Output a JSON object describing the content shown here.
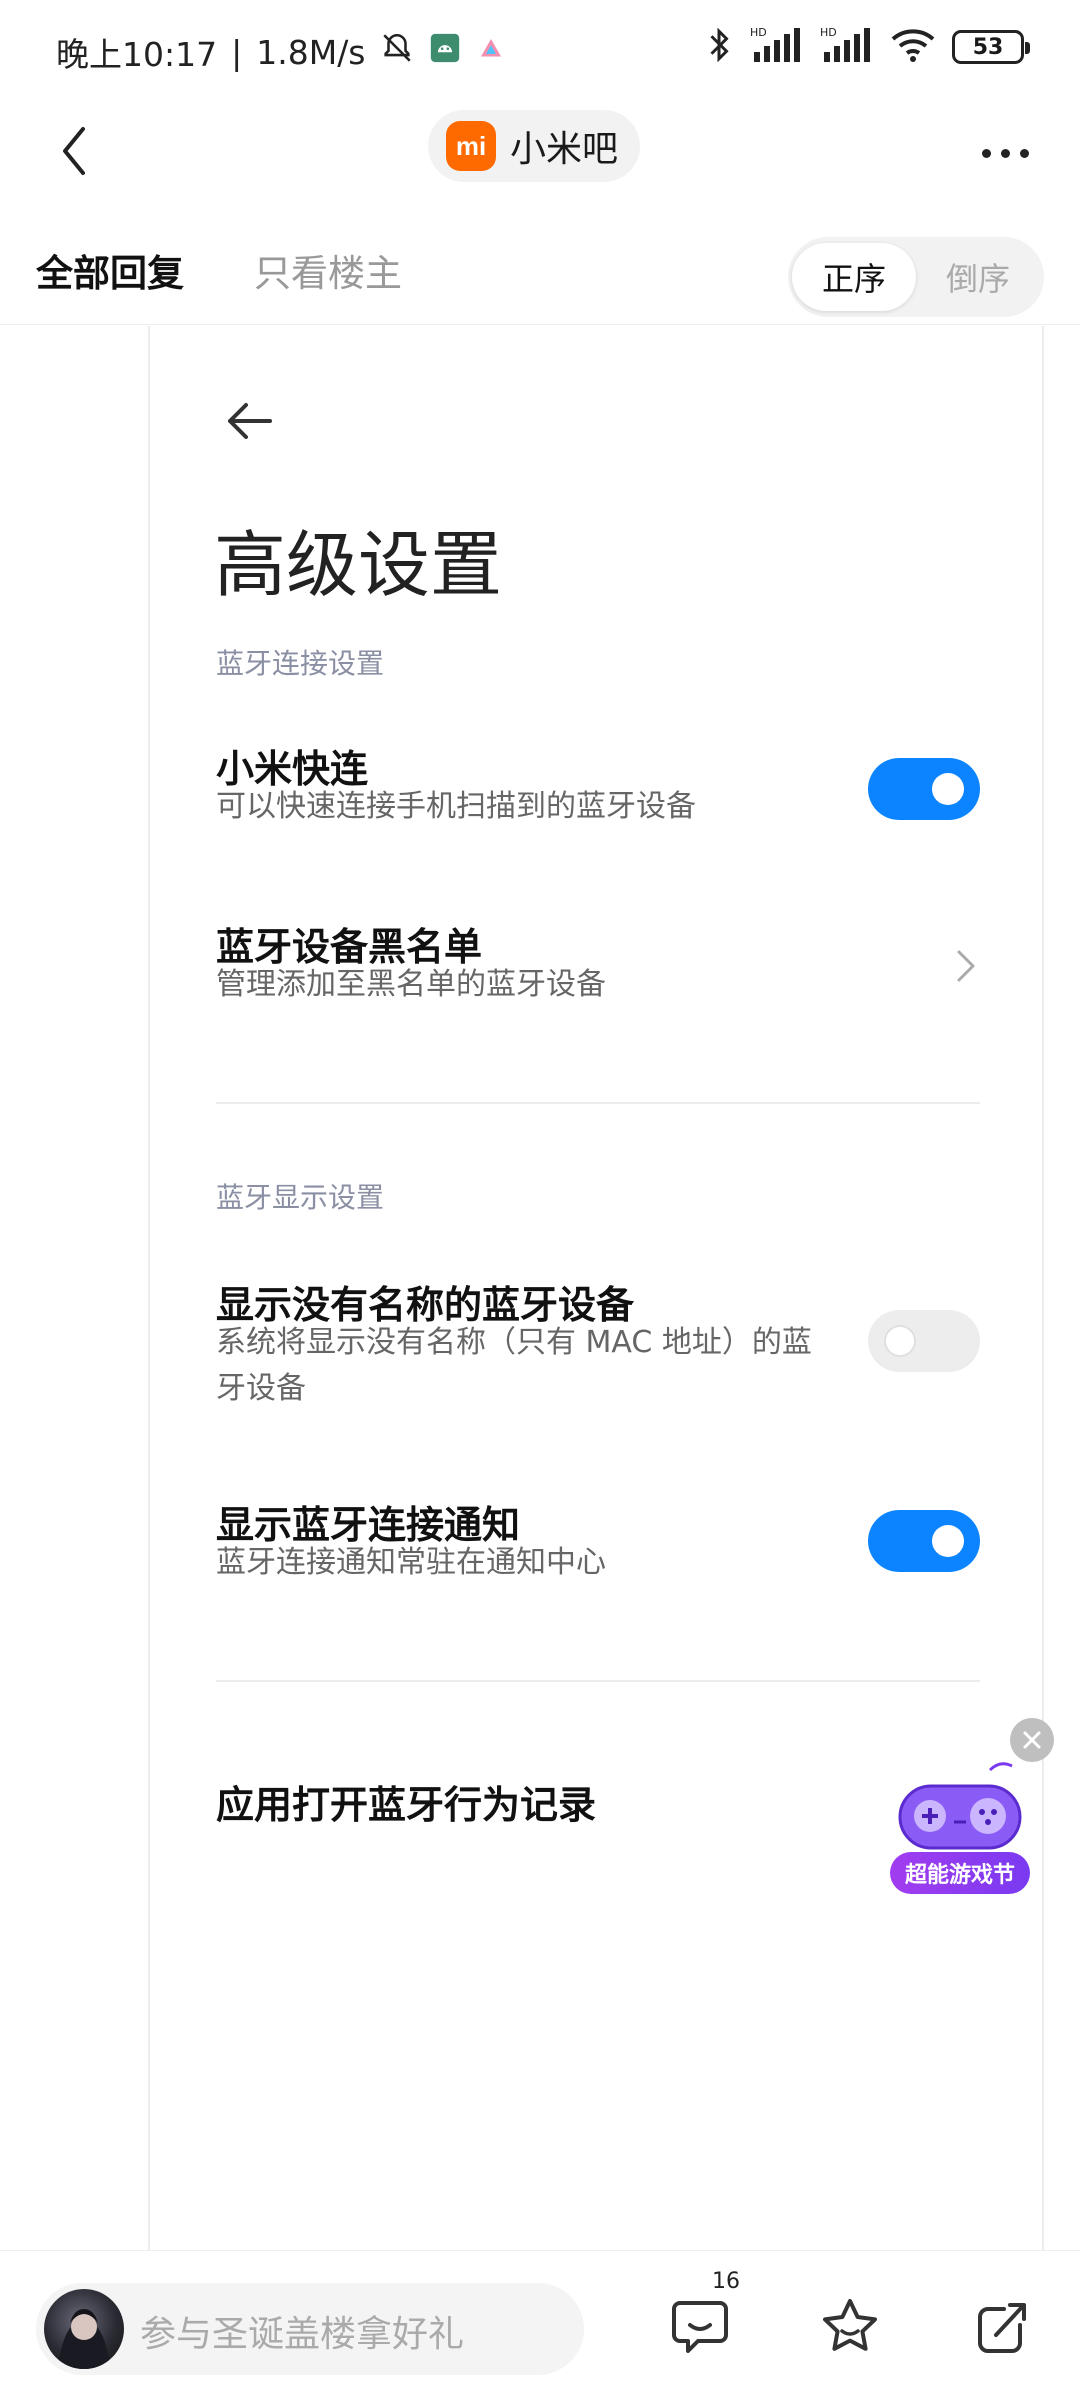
{
  "status_bar": {
    "time": "晚上10:17",
    "speed": "1.8M/s",
    "battery": "53",
    "icons": [
      "mute-bell-icon",
      "android-notification-icon",
      "app-notification-icon",
      "bluetooth-icon",
      "hd-signal-icon",
      "wifi-icon",
      "battery-icon"
    ]
  },
  "header": {
    "forum_name": "小米吧",
    "forum_logo_text": "mi"
  },
  "tabs": {
    "all_replies": "全部回复",
    "op_only": "只看楼主",
    "order_asc": "正序",
    "order_desc": "倒序"
  },
  "screenshot": {
    "page_title": "高级设置",
    "section1_label": "蓝牙连接设置",
    "quick_connect_title": "小米快连",
    "quick_connect_desc": "可以快速连接手机扫描到的蓝牙设备",
    "quick_connect_on": true,
    "blacklist_title": "蓝牙设备黑名单",
    "blacklist_desc": "管理添加至黑名单的蓝牙设备",
    "section2_label": "蓝牙显示设置",
    "show_unnamed_title": "显示没有名称的蓝牙设备",
    "show_unnamed_desc": "系统将显示没有名称（只有 MAC 地址）的蓝牙设备",
    "show_unnamed_on": false,
    "notify_title": "显示蓝牙连接通知",
    "notify_desc": "蓝牙连接通知常驻在通知中心",
    "notify_on": true,
    "app_record_title": "应用打开蓝牙行为记录"
  },
  "float_ad": {
    "label": "超能游戏节"
  },
  "bottom_bar": {
    "reply_placeholder": "参与圣诞盖楼拿好礼",
    "comment_count": "16"
  },
  "colors": {
    "toggle_on": "#0d84ff",
    "brand_orange": "#ff6a00",
    "ad_purple": "#8a3cf0"
  }
}
